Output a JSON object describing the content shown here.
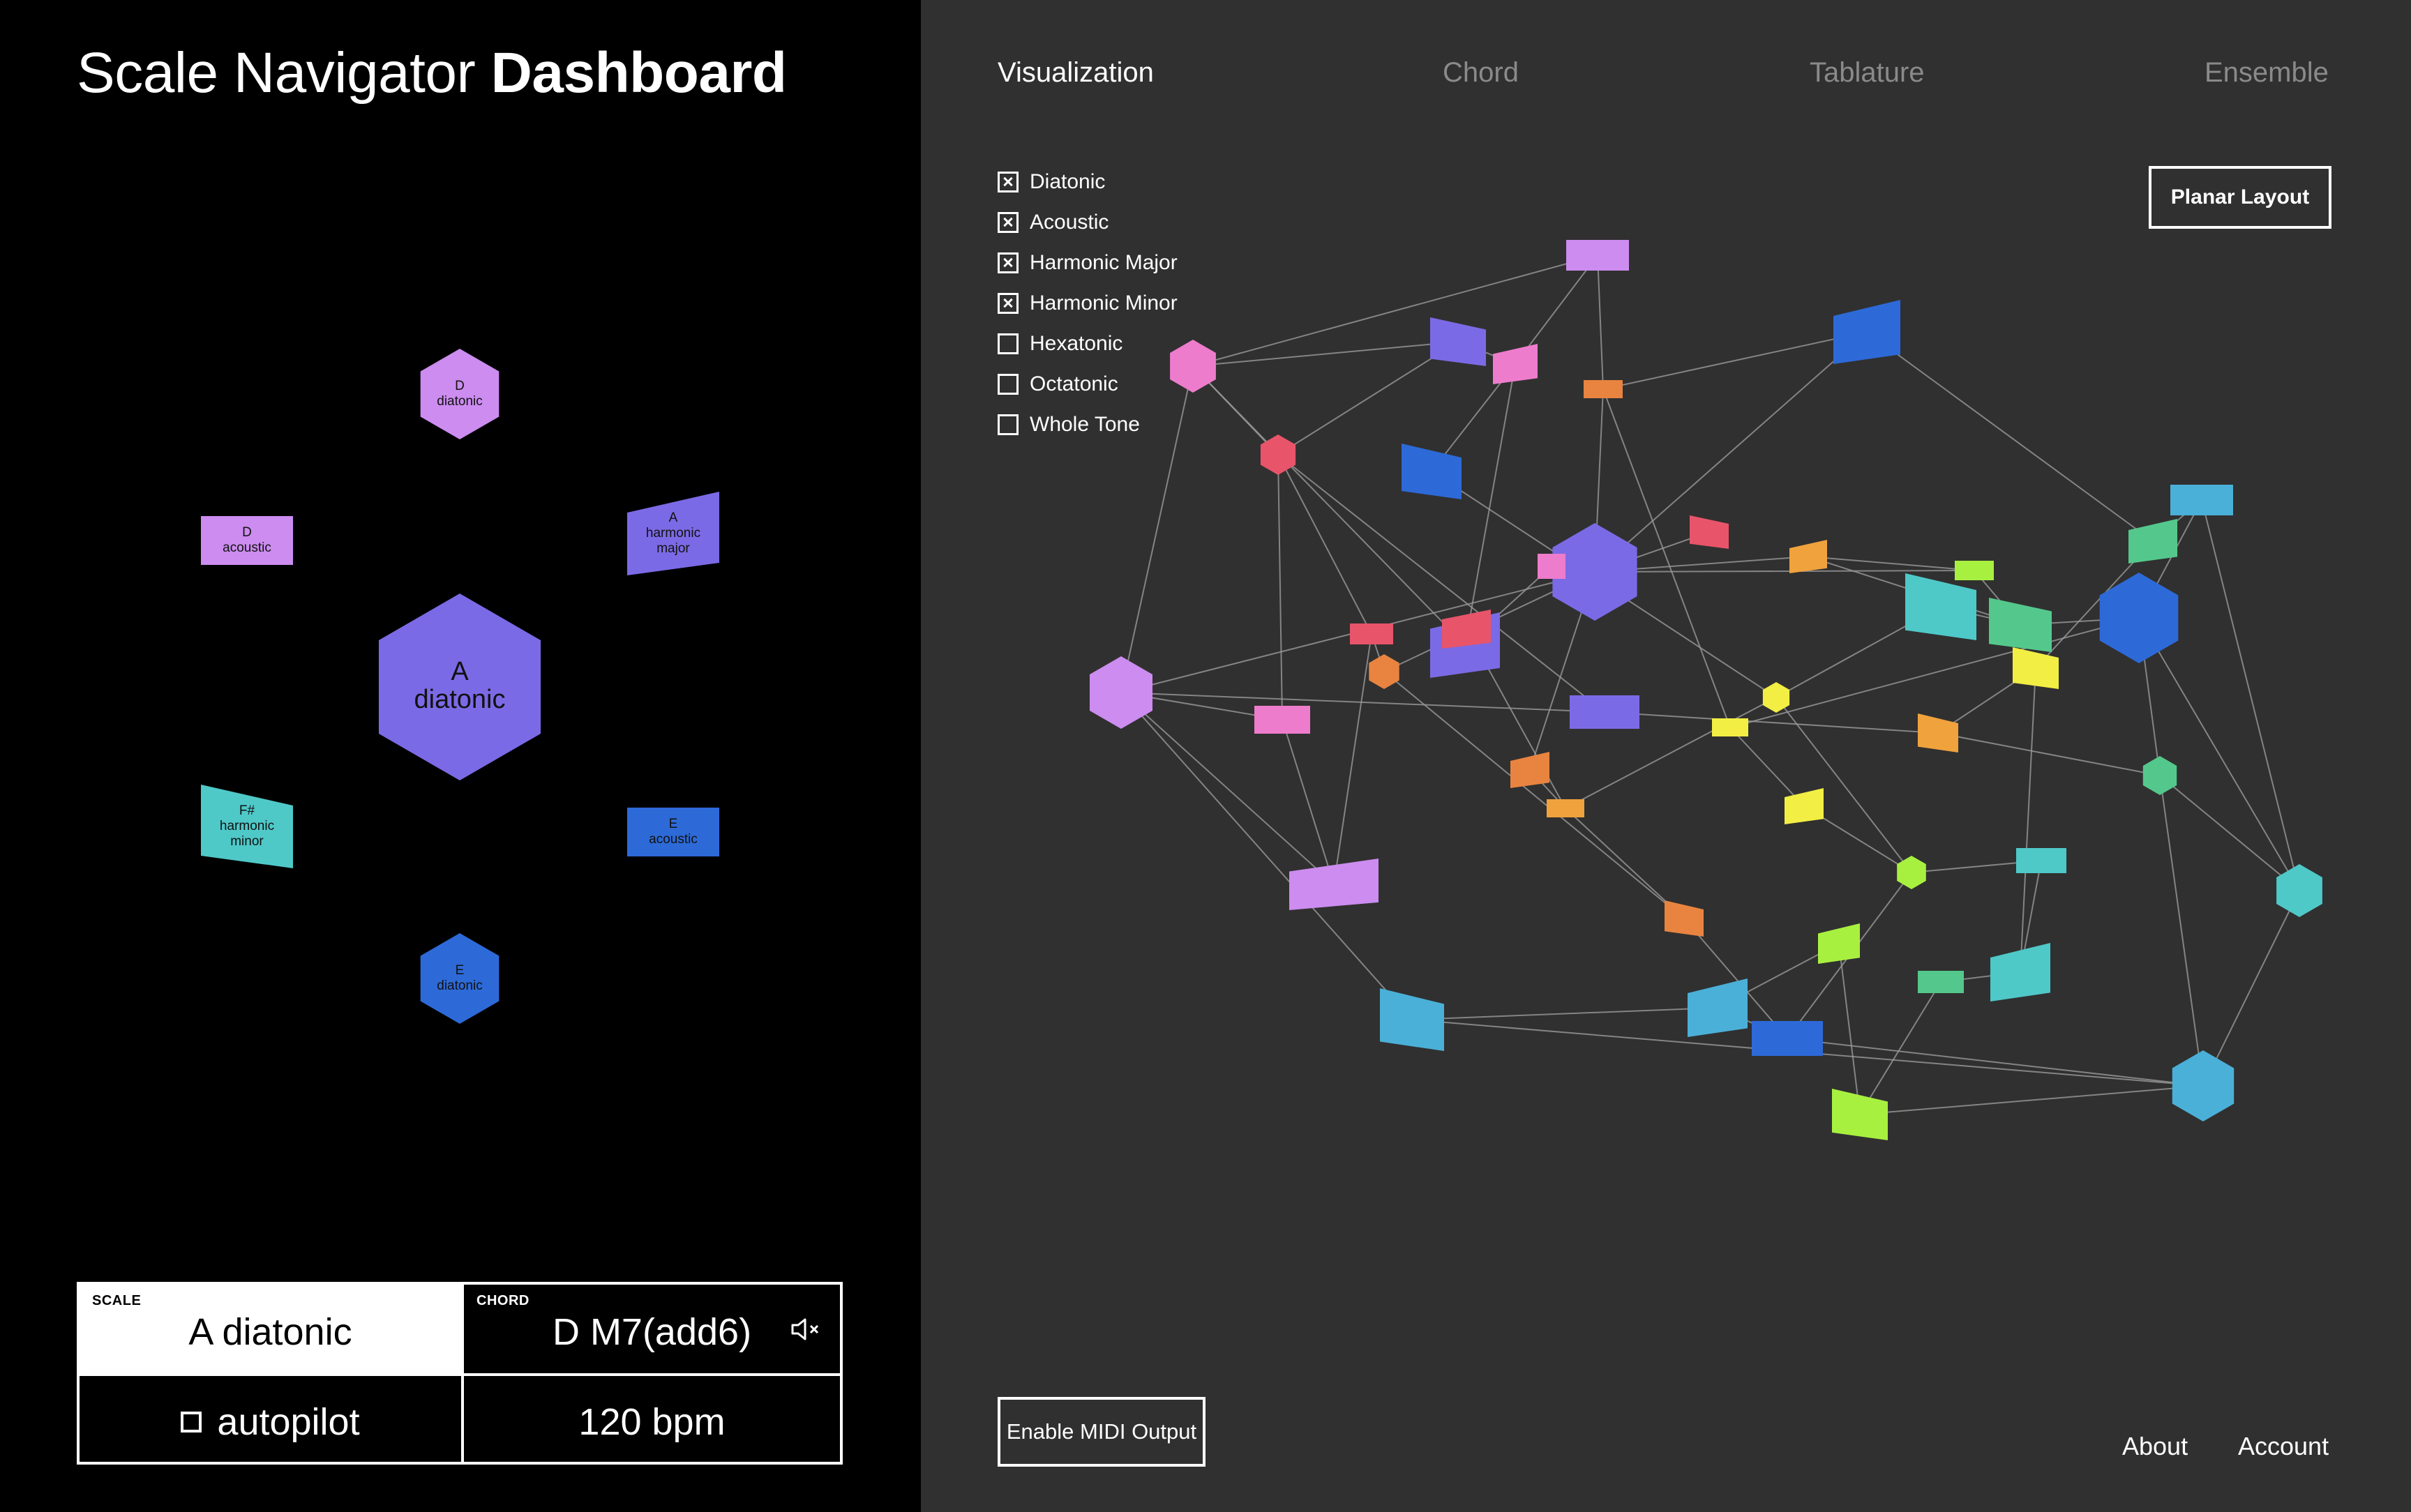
{
  "header": {
    "title_light": "Scale Navigator ",
    "title_bold": "Dashboard"
  },
  "neighbors": {
    "center": {
      "line1": "A",
      "line2": "diatonic",
      "color": "#7b6ae6"
    },
    "items": [
      {
        "lines": [
          "D",
          "diatonic"
        ],
        "shape": "hexagon",
        "color": "#cc8cf0"
      },
      {
        "lines": [
          "D",
          "acoustic"
        ],
        "shape": "rect",
        "color": "#cc8cf0"
      },
      {
        "lines": [
          "A",
          "harmonic",
          "major"
        ],
        "shape": "trap-right",
        "color": "#7b6ae6"
      },
      {
        "lines": [
          "F#",
          "harmonic",
          "minor"
        ],
        "shape": "trap-left",
        "color": "#4fc8c8"
      },
      {
        "lines": [
          "E",
          "acoustic"
        ],
        "shape": "rect",
        "color": "#2d6ad8"
      },
      {
        "lines": [
          "E",
          "diatonic"
        ],
        "shape": "hexagon",
        "color": "#2d6ad8"
      }
    ]
  },
  "info": {
    "scale_label": "SCALE",
    "scale_value": "A diatonic",
    "chord_label": "CHORD",
    "chord_value": "D M7(add6)",
    "mute_icon": "speaker-muted-icon",
    "autopilot": "autopilot",
    "bpm": "120 bpm"
  },
  "tabs": [
    "Visualization",
    "Chord",
    "Tablature",
    "Ensemble"
  ],
  "active_tab": "Visualization",
  "filters": [
    {
      "label": "Diatonic",
      "checked": true
    },
    {
      "label": "Acoustic",
      "checked": true
    },
    {
      "label": "Harmonic Major",
      "checked": true
    },
    {
      "label": "Harmonic Minor",
      "checked": true
    },
    {
      "label": "Hexatonic",
      "checked": false
    },
    {
      "label": "Octatonic",
      "checked": false
    },
    {
      "label": "Whole Tone",
      "checked": false
    }
  ],
  "planar_button": "Planar Layout",
  "midi_button": "Enable MIDI Output",
  "footer": {
    "about": "About",
    "account": "Account"
  },
  "graph_colors": {
    "violet": "#7b6ae6",
    "lavender": "#cc8cf0",
    "pink": "#ee7ccc",
    "red": "#e8546a",
    "orange": "#e88440",
    "amber": "#f0a23c",
    "yellow": "#f2ee44",
    "lime": "#a8f040",
    "green": "#54c88c",
    "teal": "#4fc8c8",
    "cyan": "#4ab0d8",
    "blue": "#2d6ad8"
  }
}
